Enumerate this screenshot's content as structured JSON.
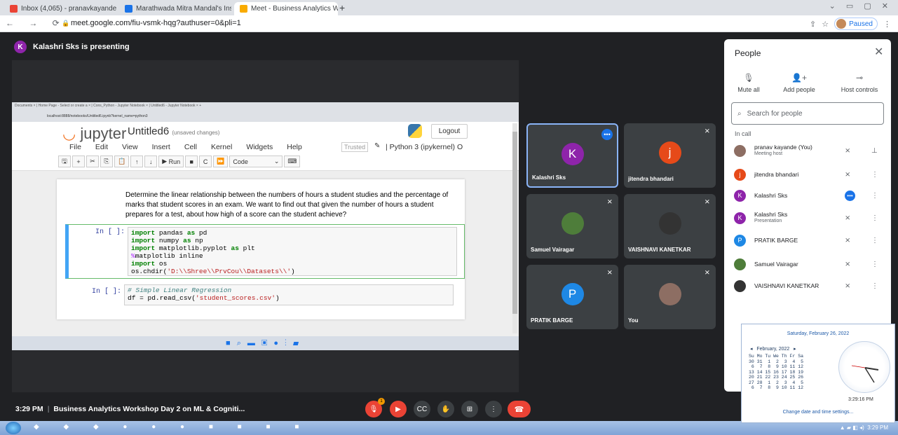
{
  "browser": {
    "tabs": [
      {
        "title": "Inbox (4,065) - pranavkayande0",
        "favicon_color": "#ea4335"
      },
      {
        "title": "Marathwada Mitra Mandal's Insti",
        "favicon_color": "#1a73e8"
      },
      {
        "title": "Meet - Business Analytics Wo",
        "favicon_color": "#f9ab00"
      }
    ],
    "url": "meet.google.com/fiu-vsmk-hqg?authuser=0&pli=1",
    "profile_label": "Paused"
  },
  "presentation": {
    "banner": "Kalashri Sks is presenting",
    "presenter_initial": "K",
    "inner_browser": {
      "tabs_text": "Documents  ×  |  Home Page - Select or create a  ×  |  Cons_Python - Jupyter Notebook  ×  |  Untitled6 - Jupyter Notebook  ×  +",
      "url": "localhost:8888/notebooks/Untitled6.ipynb?kernel_name=python3"
    },
    "jupyter": {
      "logo": "jupyter",
      "notebook_title": "Untitled6",
      "unsaved": "(unsaved changes)",
      "logout": "Logout",
      "menu": [
        "File",
        "Edit",
        "View",
        "Insert",
        "Cell",
        "Kernel",
        "Widgets",
        "Help"
      ],
      "trusted": "Trusted",
      "kernel": "Python 3 (ipykernel) O",
      "run_label": "Run",
      "cell_type": "Code",
      "markdown": "Determine the linear relationship between the numbers of hours a student studies and the percentage of marks that student scores in an exam. We want to find out that given the number of hours a student prepares for a test, about how high of a score can the student achieve?",
      "cells": [
        {
          "prompt": "In [ ]:"
        },
        {
          "prompt": "In [ ]:"
        }
      ]
    }
  },
  "participants": [
    {
      "name": "Kalashri Sks",
      "initial": "K",
      "color": "#8e24aa"
    },
    {
      "name": "jitendra bhandari",
      "initial": "j",
      "color": "#e64a19"
    },
    {
      "name": "Samuel Vairagar",
      "initial": "",
      "color": "#4e7d3a"
    },
    {
      "name": "VAISHNAVI KANETKAR",
      "initial": "",
      "color": "#333333"
    },
    {
      "name": "PRATIK BARGE",
      "initial": "P",
      "color": "#1e88e5"
    },
    {
      "name": "You",
      "initial": "",
      "color": "#8d6e63"
    }
  ],
  "people_panel": {
    "title": "People",
    "controls": [
      "Mute all",
      "Add people",
      "Host controls"
    ],
    "search_placeholder": "Search for people",
    "section": "In call",
    "list": [
      {
        "name": "pranav kayande (You)",
        "sub": "Meeting host",
        "initial": "",
        "color": "#8d6e63"
      },
      {
        "name": "jitendra bhandari",
        "sub": "",
        "initial": "j",
        "color": "#e64a19"
      },
      {
        "name": "Kalashri Sks",
        "sub": "",
        "initial": "K",
        "color": "#8e24aa"
      },
      {
        "name": "Kalashri Sks",
        "sub": "Presentation",
        "initial": "K",
        "color": "#8e24aa"
      },
      {
        "name": "PRATIK BARGE",
        "sub": "",
        "initial": "P",
        "color": "#1e88e5"
      },
      {
        "name": "Samuel Vairagar",
        "sub": "",
        "initial": "",
        "color": "#4e7d3a"
      },
      {
        "name": "VAISHNAVI KANETKAR",
        "sub": "",
        "initial": "",
        "color": "#333333"
      }
    ]
  },
  "meeting_bar": {
    "time": "3:29 PM",
    "title": "Business Analytics Workshop Day 2 on ML & Cogniti...",
    "badge_count": "1"
  },
  "windows": {
    "clock_popup": {
      "date": "Saturday, February 26, 2022",
      "month": "February, 2022",
      "time": "3:29:16 PM",
      "settings_link": "Change date and time settings..."
    },
    "tray_time": "3:29 PM"
  }
}
